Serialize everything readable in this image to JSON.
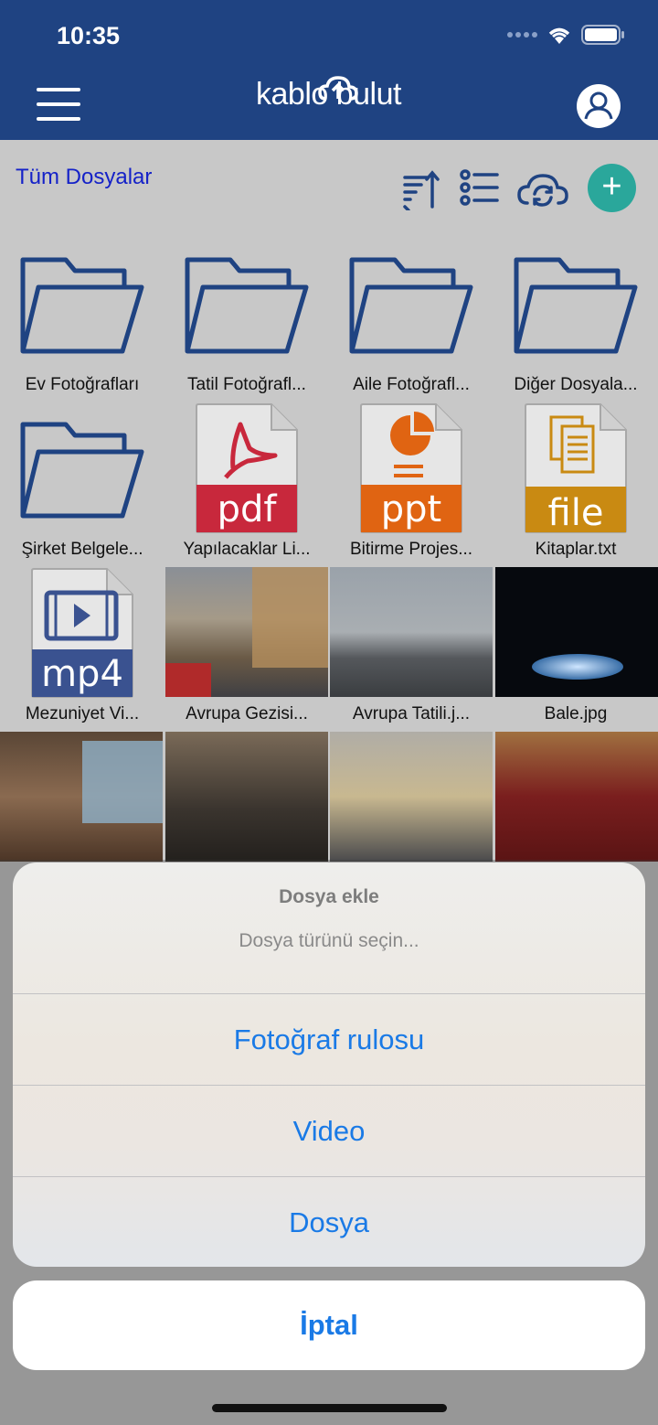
{
  "status_bar": {
    "time": "10:35"
  },
  "header": {
    "logo": "kablo bulut"
  },
  "toolbar": {
    "breadcrumb": "Tüm Dosyalar"
  },
  "files": [
    {
      "name": "Ev Fotoğrafları",
      "kind": "folder-icon"
    },
    {
      "name": "Tatil Fotoğrafl...",
      "kind": "folder-icon"
    },
    {
      "name": "Aile Fotoğrafl...",
      "kind": "folder-icon"
    },
    {
      "name": "Diğer Dosyala...",
      "kind": "folder-icon"
    },
    {
      "name": "Şirket Belgele...",
      "kind": "folder-icon"
    },
    {
      "name": "Yapılacaklar Li...",
      "kind": "pdf-file-icon",
      "badge": "pdf",
      "color": "#c8283c"
    },
    {
      "name": "Bitirme Projes...",
      "kind": "ppt-file-icon",
      "badge": "ppt",
      "color": "#e06412"
    },
    {
      "name": "Kitaplar.txt",
      "kind": "txt-file-icon",
      "badge": "file",
      "color": "#c98a12"
    },
    {
      "name": "Mezuniyet Vi...",
      "kind": "mp4-file-icon",
      "badge": "mp4",
      "color": "#3a5290"
    },
    {
      "name": "Avrupa Gezisi...",
      "kind": "photo"
    },
    {
      "name": "Avrupa Tatili.j...",
      "kind": "photo"
    },
    {
      "name": "Bale.jpg",
      "kind": "photo"
    }
  ],
  "sheet": {
    "title": "Dosya ekle",
    "message": "Dosya türünü seçin...",
    "actions": [
      "Fotoğraf rulosu",
      "Video",
      "Dosya"
    ],
    "cancel": "İptal"
  }
}
